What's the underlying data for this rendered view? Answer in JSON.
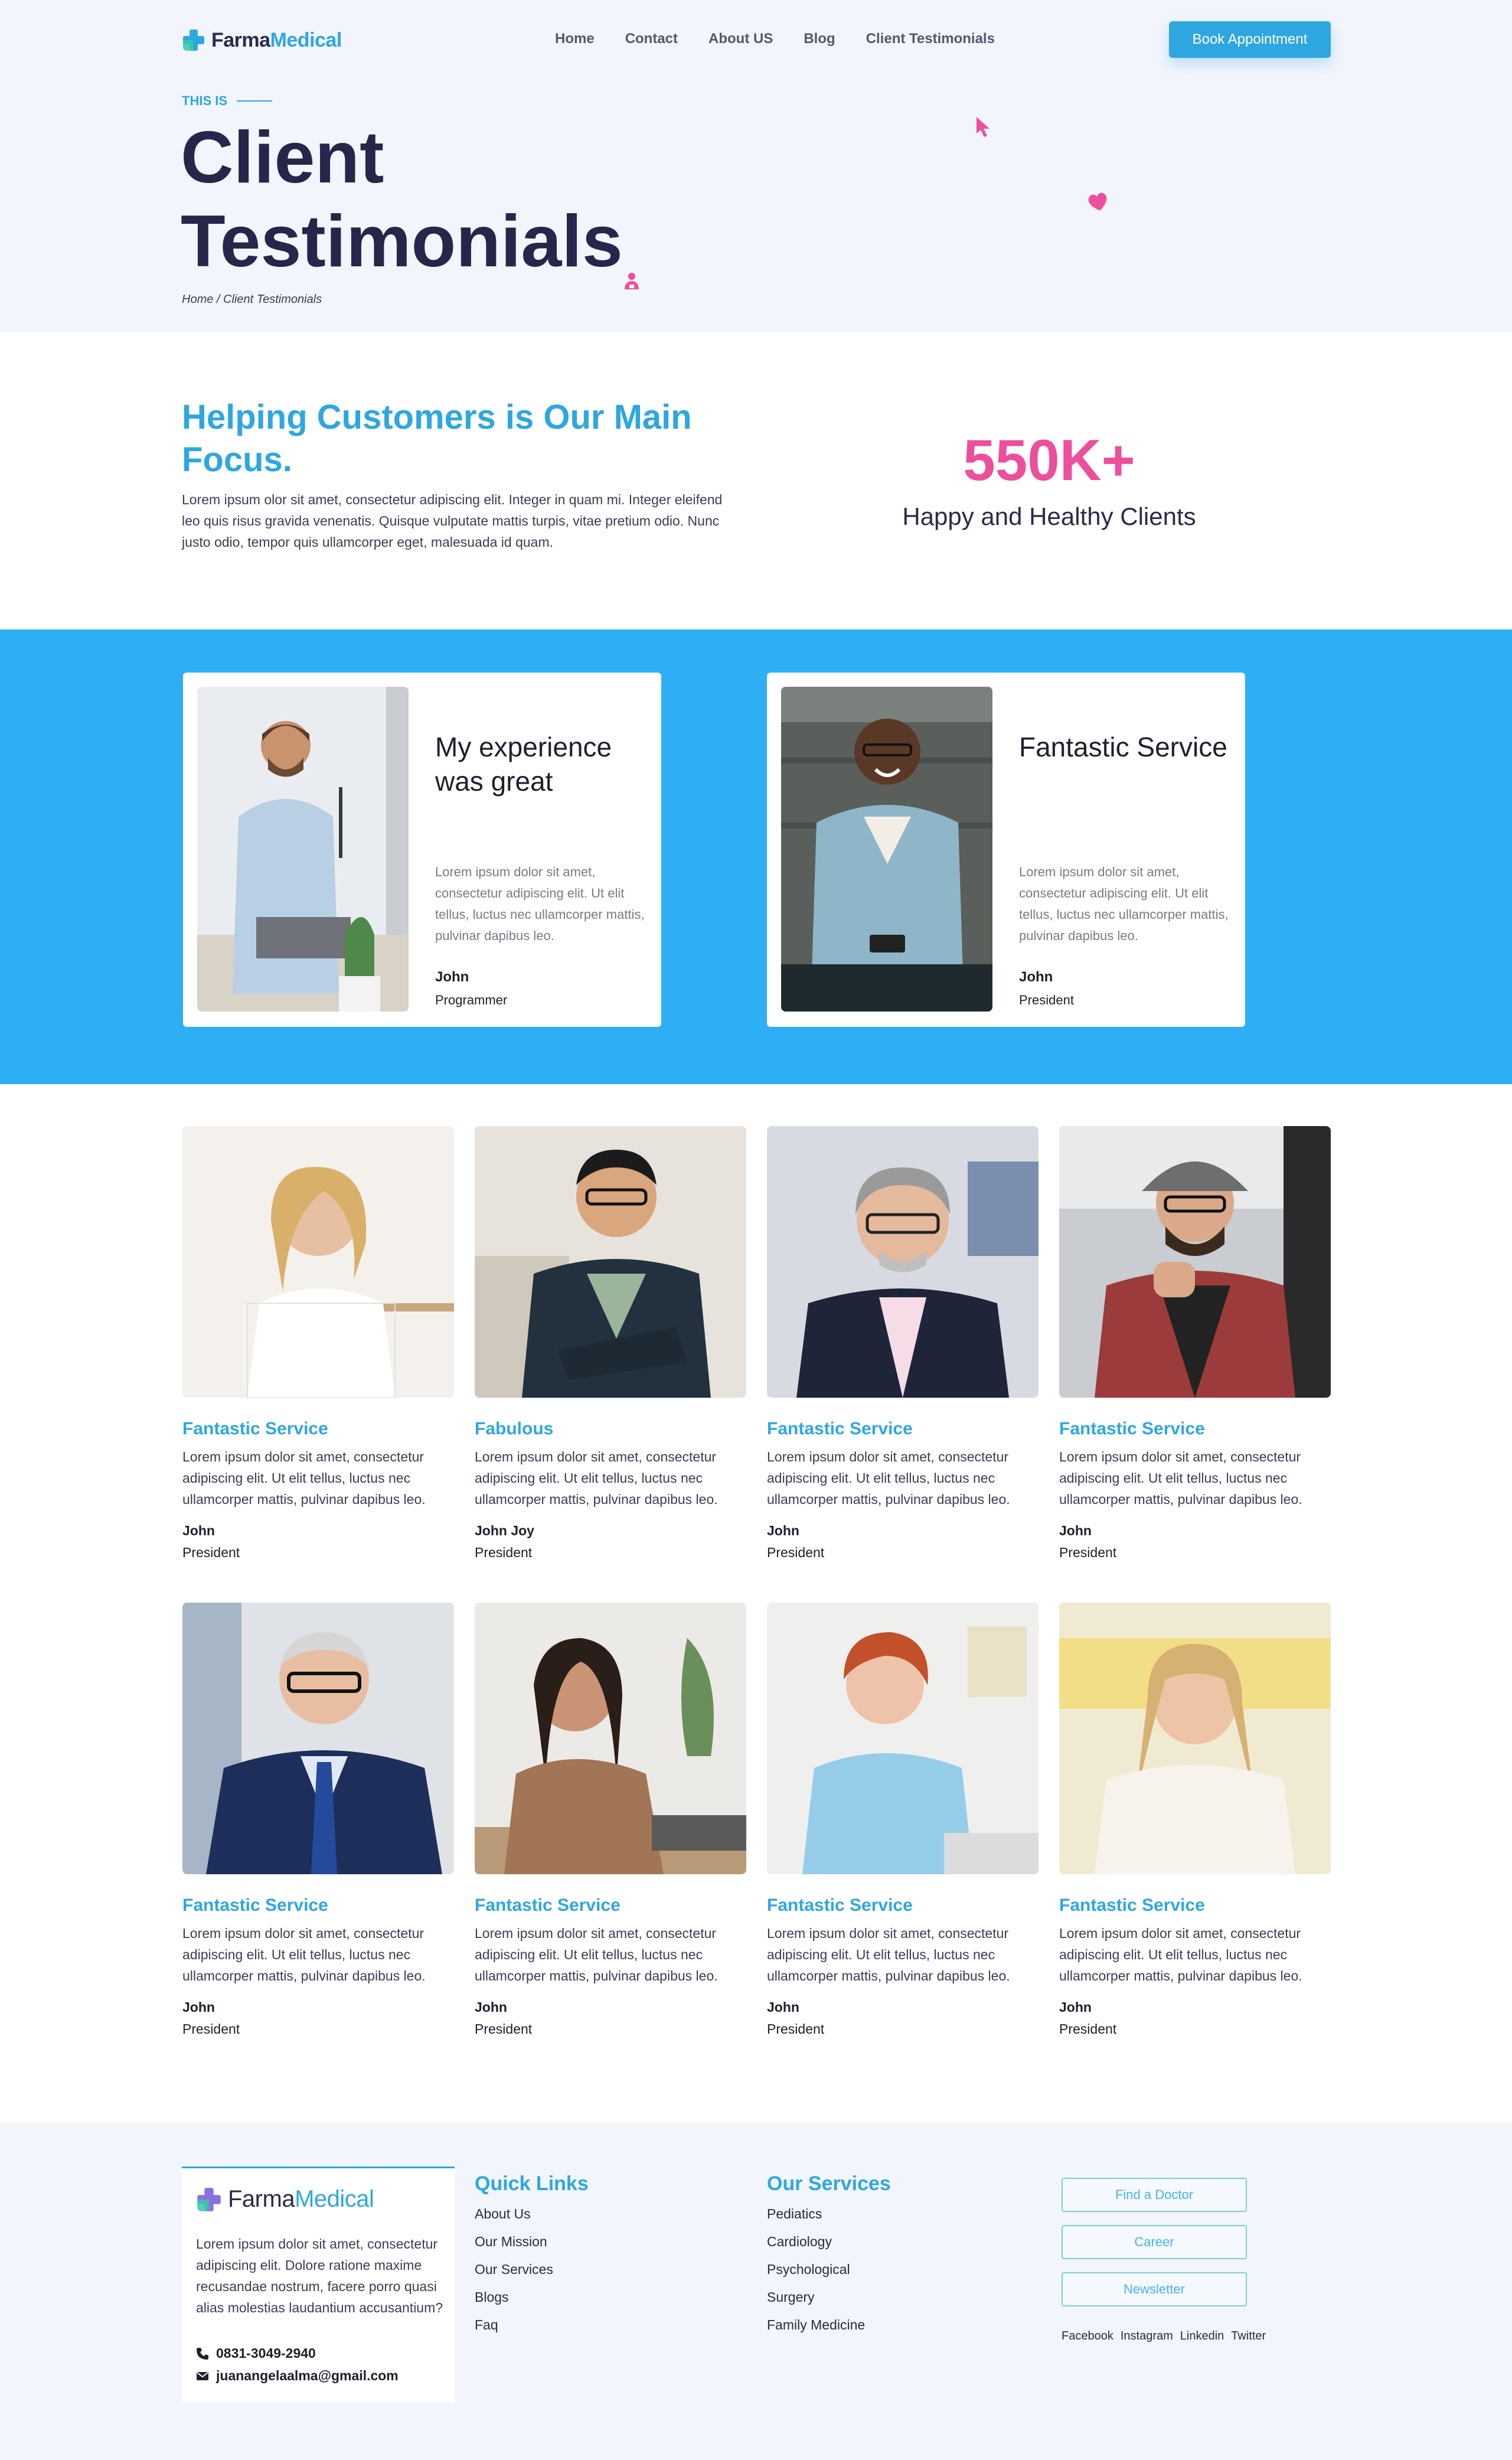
{
  "brand": {
    "part1": "Farma",
    "part2": "Medical",
    "primary_color": "#2ea7e0",
    "accent_color": "#ec4f9c",
    "dark_color": "#26264a"
  },
  "nav": {
    "items": [
      "Home",
      "Contact",
      "About US",
      "Blog",
      "Client Testimonials"
    ],
    "cta": "Book Appointment"
  },
  "hero": {
    "eyebrow": "THIS IS",
    "title": "Client Testimonials",
    "breadcrumb": "Home / Client Testimonials",
    "decor_icons": [
      "cursor-icon",
      "heart-icon",
      "doctor-icon"
    ]
  },
  "stats": {
    "title": "Helping Customers is Our Main Focus.",
    "body": "Lorem ipsum olor sit amet, consectetur adipiscing elit. Integer in quam mi. Integer eleifend leo quis risus gravida venenatis. Quisque vulputate mattis turpis, vitae pretium odio. Nunc justo odio, tempor quis ullamcorper eget, malesuada id quam.",
    "number": "550K+",
    "number_label": "Happy and Healthy Clients"
  },
  "featured": [
    {
      "title": "My experience was great",
      "body": "Lorem ipsum dolor sit amet, consectetur adipiscing elit. Ut elit tellus, luctus nec ullamcorper mattis, pulvinar dapibus leo.",
      "name": "John",
      "role": "Programmer"
    },
    {
      "title": "Fantastic Service",
      "body": "Lorem ipsum dolor sit amet, consectetur adipiscing elit. Ut elit tellus, luctus nec ullamcorper mattis, pulvinar dapibus leo.",
      "name": "John",
      "role": "President"
    }
  ],
  "testimonials": [
    {
      "title": "Fantastic Service",
      "body": "Lorem ipsum dolor sit amet, consectetur adipiscing elit. Ut elit tellus, luctus nec ullamcorper mattis, pulvinar dapibus leo.",
      "name": "John",
      "role": "President"
    },
    {
      "title": "Fabulous",
      "body": "Lorem ipsum dolor sit amet, consectetur adipiscing elit. Ut elit tellus, luctus nec ullamcorper mattis, pulvinar dapibus leo.",
      "name": "John Joy",
      "role": "President"
    },
    {
      "title": "Fantastic Service",
      "body": "Lorem ipsum dolor sit amet, consectetur adipiscing elit. Ut elit tellus, luctus nec ullamcorper mattis, pulvinar dapibus leo.",
      "name": "John",
      "role": "President"
    },
    {
      "title": "Fantastic Service",
      "body": "Lorem ipsum dolor sit amet, consectetur adipiscing elit. Ut elit tellus, luctus nec ullamcorper mattis, pulvinar dapibus leo.",
      "name": "John",
      "role": "President"
    },
    {
      "title": "Fantastic Service",
      "body": "Lorem ipsum dolor sit amet, consectetur adipiscing elit. Ut elit tellus, luctus nec ullamcorper mattis, pulvinar dapibus leo.",
      "name": "John",
      "role": "President"
    },
    {
      "title": "Fantastic Service",
      "body": "Lorem ipsum dolor sit amet, consectetur adipiscing elit. Ut elit tellus, luctus nec ullamcorper mattis, pulvinar dapibus leo.",
      "name": "John",
      "role": "President"
    },
    {
      "title": "Fantastic Service",
      "body": "Lorem ipsum dolor sit amet, consectetur adipiscing elit. Ut elit tellus, luctus nec ullamcorper mattis, pulvinar dapibus leo.",
      "name": "John",
      "role": "President"
    },
    {
      "title": "Fantastic Service",
      "body": "Lorem ipsum dolor sit amet, consectetur adipiscing elit. Ut elit tellus, luctus nec ullamcorper mattis, pulvinar dapibus leo.",
      "name": "John",
      "role": "President"
    }
  ],
  "footer": {
    "description": "Lorem ipsum dolor sit amet, consectetur adipiscing elit. Dolore ratione maxime recusandae nostrum, facere porro quasi alias molestias laudantium accusantium?",
    "phone": "0831-3049-2940",
    "email": "juanangelaalma@gmail.com",
    "quick_links_title": "Quick Links",
    "quick_links": [
      "About Us",
      "Our Mission",
      "Our Services",
      "Blogs",
      "Faq"
    ],
    "services_title": "Our Services",
    "services": [
      "Pediatics",
      "Cardiology",
      "Psychological",
      "Surgery",
      "Family Medicine"
    ],
    "buttons": [
      "Find a Doctor",
      "Career",
      "Newsletter"
    ],
    "social": [
      "Facebook",
      "Instagram",
      "Linkedin",
      "Twitter"
    ]
  }
}
